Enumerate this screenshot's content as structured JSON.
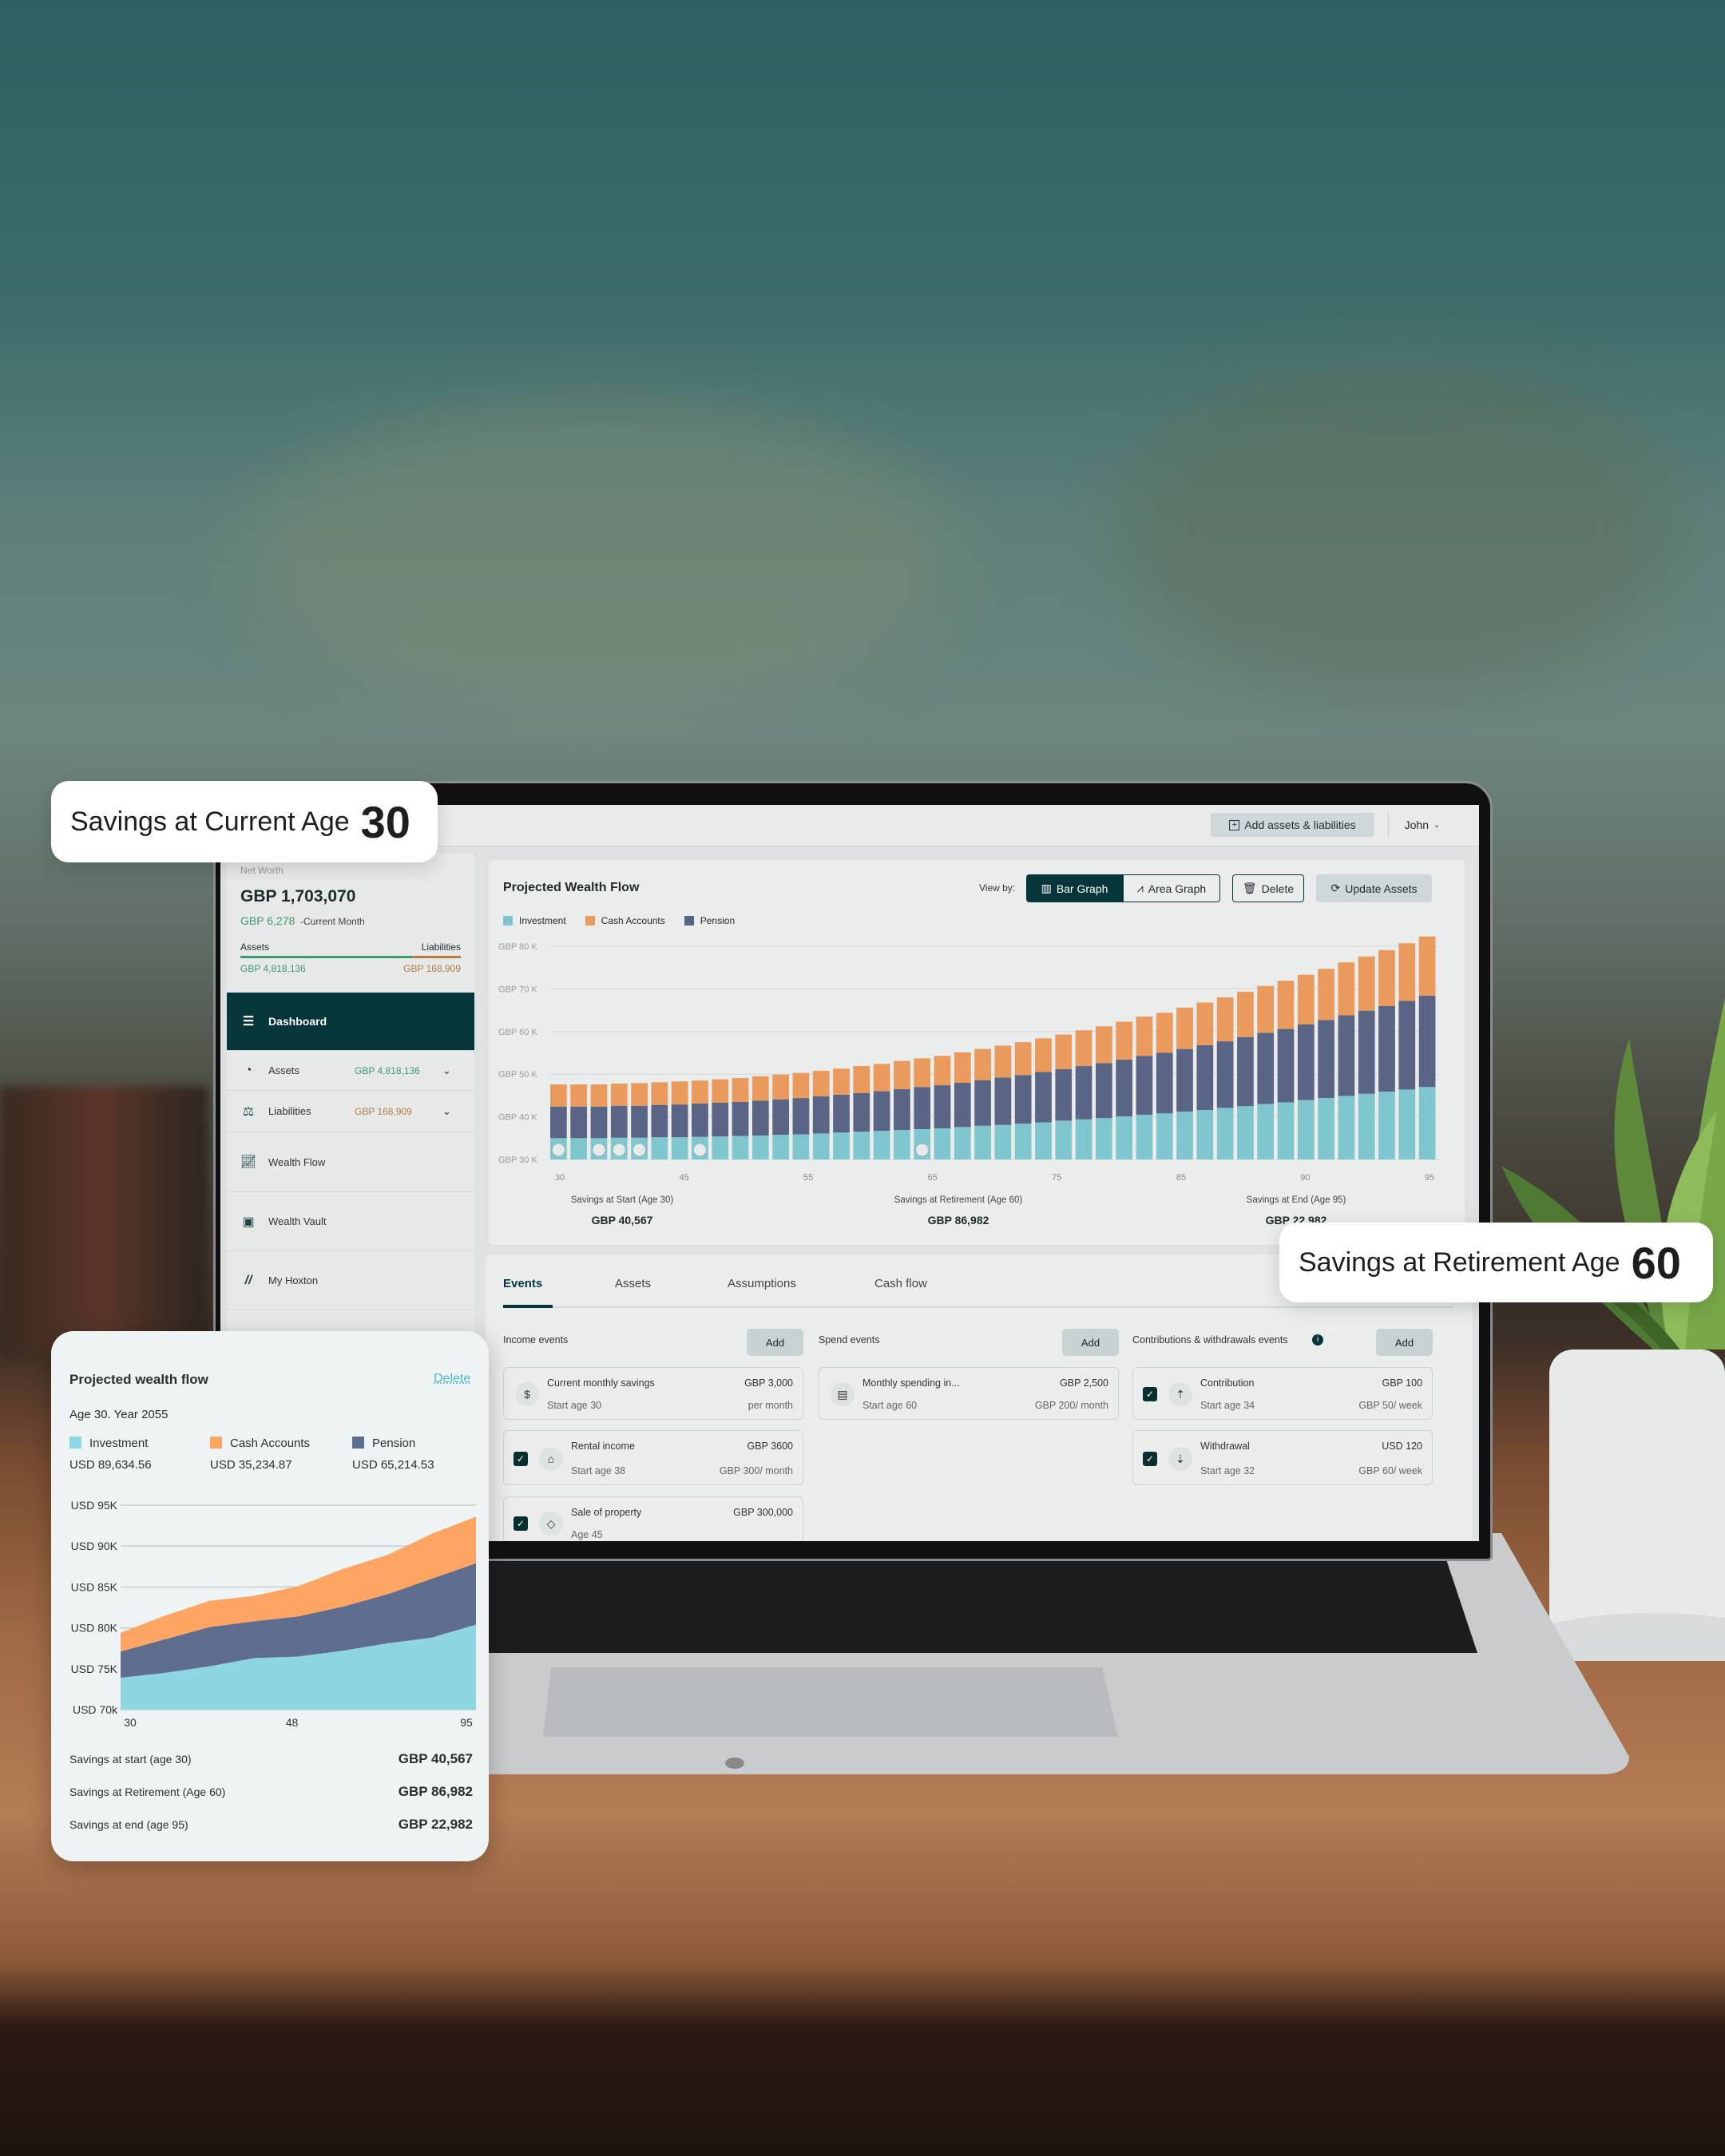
{
  "callouts": {
    "current": {
      "label": "Savings at Current Age",
      "value": "30"
    },
    "retirement": {
      "label": "Savings at Retirement Age",
      "value": "60"
    }
  },
  "colors": {
    "brand_dark": "#06363a",
    "investment": "#7fc6cf",
    "cash_accounts": "#e99a5c",
    "pension": "#5a6585",
    "asset_green": "#3e9a6a",
    "liability_brown": "#b57a45"
  },
  "topbar": {
    "add_button": "Add assets & liabilities",
    "add_icon": "plus-square-icon",
    "user": "John"
  },
  "sidebar": {
    "net_worth_label": "Net Worth",
    "net_worth": "GBP 1,703,070",
    "monthly_change": "GBP 6,278",
    "monthly_label": "-Current Month",
    "assets_label": "Assets",
    "liabilities_label": "Liabilities",
    "assets_value": "GBP 4,818,136",
    "liabilities_value": "GBP 168,909",
    "assets_share": 0.78,
    "items": [
      {
        "label": "Dashboard",
        "icon": "layers-icon",
        "active": true
      },
      {
        "label": "Assets",
        "icon": "pie-chart-icon",
        "value": "GBP 4,818,136"
      },
      {
        "label": "Liabilities",
        "icon": "scale-icon",
        "value": "GBP 168,909"
      },
      {
        "label": "Wealth Flow",
        "icon": "line-chart-icon"
      },
      {
        "label": "Wealth Vault",
        "icon": "vault-icon"
      },
      {
        "label": "My Hoxton",
        "icon": "hoxton-logo-icon"
      }
    ]
  },
  "wealth_panel": {
    "title": "Projected Wealth Flow",
    "view_by": "View by:",
    "bar_graph": "Bar Graph",
    "area_graph": "Area Graph",
    "delete": "Delete",
    "update": "Update Assets",
    "summary": [
      {
        "label": "Savings at Start (Age 30)",
        "value": "GBP 40,567"
      },
      {
        "label": "Savings at Retirement (Age 60)",
        "value": "GBP 86,982"
      },
      {
        "label": "Savings at End (Age 95)",
        "value": "GBP 22,982"
      }
    ]
  },
  "chart_data": [
    {
      "type": "bar",
      "stacked": true,
      "ylim": [
        30,
        80
      ],
      "y_tick_labels": [
        "GBP 30 K",
        "GBP 40 K",
        "GBP 50 K",
        "GBP 60 K",
        "GBP 70 K",
        "GBP 80 K"
      ],
      "y_ticks": [
        30,
        40,
        50,
        60,
        70,
        80
      ],
      "x_tick_labels": [
        "30",
        "45",
        "55",
        "65",
        "75",
        "85",
        "90",
        "95"
      ],
      "grid": true,
      "legend": "top-left",
      "series": [
        {
          "name": "Investment",
          "values": [
            35.0,
            35.0,
            35.0,
            35.1,
            35.1,
            35.2,
            35.2,
            35.3,
            35.4,
            35.5,
            35.6,
            35.8,
            35.9,
            36.1,
            36.3,
            36.5,
            36.7,
            36.9,
            37.1,
            37.3,
            37.6,
            37.9,
            38.1,
            38.4,
            38.7,
            39.1,
            39.4,
            39.7,
            40.1,
            40.5,
            40.8,
            41.2,
            41.6,
            42.1,
            42.5,
            43.0,
            43.4,
            43.9,
            44.4,
            44.9,
            45.4,
            45.9,
            46.4,
            47.0
          ]
        },
        {
          "name": "Pension",
          "values": [
            7.4,
            7.4,
            7.4,
            7.5,
            7.5,
            7.6,
            7.7,
            7.8,
            7.9,
            8.0,
            8.2,
            8.3,
            8.5,
            8.7,
            8.9,
            9.1,
            9.3,
            9.6,
            9.9,
            10.1,
            10.4,
            10.7,
            11.1,
            11.4,
            11.8,
            12.1,
            12.5,
            12.9,
            13.3,
            13.8,
            14.2,
            14.7,
            15.2,
            15.6,
            16.2,
            16.7,
            17.2,
            17.8,
            18.3,
            18.9,
            19.5,
            20.1,
            20.8,
            21.4
          ]
        },
        {
          "name": "Cash Accounts",
          "values": [
            5.2,
            5.2,
            5.2,
            5.2,
            5.3,
            5.3,
            5.4,
            5.4,
            5.5,
            5.6,
            5.7,
            5.8,
            5.9,
            6.0,
            6.1,
            6.3,
            6.4,
            6.6,
            6.7,
            6.9,
            7.1,
            7.3,
            7.5,
            7.7,
            7.9,
            8.1,
            8.4,
            8.6,
            8.9,
            9.2,
            9.4,
            9.7,
            10.0,
            10.3,
            10.6,
            11.0,
            11.3,
            11.6,
            12.0,
            12.4,
            12.7,
            13.1,
            13.5,
            13.9
          ]
        }
      ],
      "legend_order": [
        "Investment",
        "Cash Accounts",
        "Pension"
      ],
      "event_markers": [
        {
          "bar": 0,
          "icon": "savings-icon"
        },
        {
          "bar": 2,
          "icon": "withdrawal-icon"
        },
        {
          "bar": 3,
          "icon": "contribution-icon"
        },
        {
          "bar": 4,
          "icon": "home-icon"
        },
        {
          "bar": 7,
          "icon": "tag-icon"
        },
        {
          "bar": 18,
          "icon": "spending-icon"
        }
      ]
    },
    {
      "type": "area",
      "stacked": true,
      "title": "Projected wealth flow",
      "ylim": [
        70,
        95
      ],
      "y_tick_labels": [
        "USD 70k",
        "USD 75K",
        "USD 80K",
        "USD 85K",
        "USD 90K",
        "USD 95K"
      ],
      "y_ticks": [
        70,
        75,
        80,
        85,
        90,
        95
      ],
      "x_tick_labels": [
        "30",
        "48",
        "95"
      ],
      "grid": true,
      "series": [
        {
          "name": "Investment",
          "values": [
            73.9,
            74.5,
            75.3,
            76.3,
            76.5,
            77.2,
            78.1,
            78.8,
            80.4
          ]
        },
        {
          "name": "Pension",
          "values": [
            3.2,
            4.1,
            4.8,
            4.5,
            4.9,
            5.4,
            6.0,
            7.2,
            7.5
          ]
        },
        {
          "name": "Cash Accounts",
          "values": [
            2.3,
            2.9,
            3.2,
            3.1,
            3.7,
            4.6,
            4.8,
            5.5,
            5.7
          ]
        }
      ]
    }
  ],
  "events_panel": {
    "tabs": [
      "Events",
      "Assets",
      "Assumptions",
      "Cash flow"
    ],
    "active_tab": "Events",
    "add": "Add",
    "columns": [
      {
        "title": "Income events",
        "cards": [
          {
            "name": "Current monthly savings",
            "sub": "Start age 30",
            "amount": "GBP 3,000",
            "rate": "per month",
            "icon": "savings-icon",
            "checkbox": false
          },
          {
            "name": "Rental income",
            "sub": "Start age 38",
            "amount": "GBP 3600",
            "rate": "GBP 300/ month",
            "icon": "home-icon",
            "checkbox": true
          },
          {
            "name": "Sale of property",
            "sub": "Age 45",
            "amount": "GBP 300,000",
            "rate": "",
            "icon": "tag-icon",
            "checkbox": true
          }
        ]
      },
      {
        "title": "Spend events",
        "cards": [
          {
            "name": "Monthly spending in...",
            "sub": "Start age 60",
            "amount": "GBP 2,500",
            "rate": "GBP 200/ month",
            "icon": "spending-icon",
            "checkbox": false
          }
        ]
      },
      {
        "title": "Contributions & withdrawals events",
        "info_icon": "info-icon",
        "cards": [
          {
            "name": "Contribution",
            "sub": "Start age 34",
            "amount": "GBP 100",
            "rate": "GBP 50/ week",
            "icon": "contribution-icon",
            "checkbox": true
          },
          {
            "name": "Withdrawal",
            "sub": "Start age 32",
            "amount": "USD 120",
            "rate": "GBP 60/ week",
            "icon": "withdrawal-icon",
            "checkbox": true
          }
        ]
      }
    ]
  },
  "left_card": {
    "title": "Projected wealth flow",
    "delete": "Delete",
    "subtitle": "Age 30. Year 2055",
    "legend": [
      {
        "name": "Investment",
        "value": "USD 89,634.56",
        "color": "#8dd6e0"
      },
      {
        "name": "Cash Accounts",
        "value": "USD 35,234.87",
        "color": "#ffa564"
      },
      {
        "name": "Pension",
        "value": "USD 65,214.53",
        "color": "#5f6d8e"
      }
    ],
    "summary": [
      {
        "label": "Savings at start (age 30)",
        "value": "GBP 40,567"
      },
      {
        "label": "Savings at Retirement (Age 60)",
        "value": "GBP 86,982"
      },
      {
        "label": "Savings at end (age 95)",
        "value": "GBP 22,982"
      }
    ]
  }
}
